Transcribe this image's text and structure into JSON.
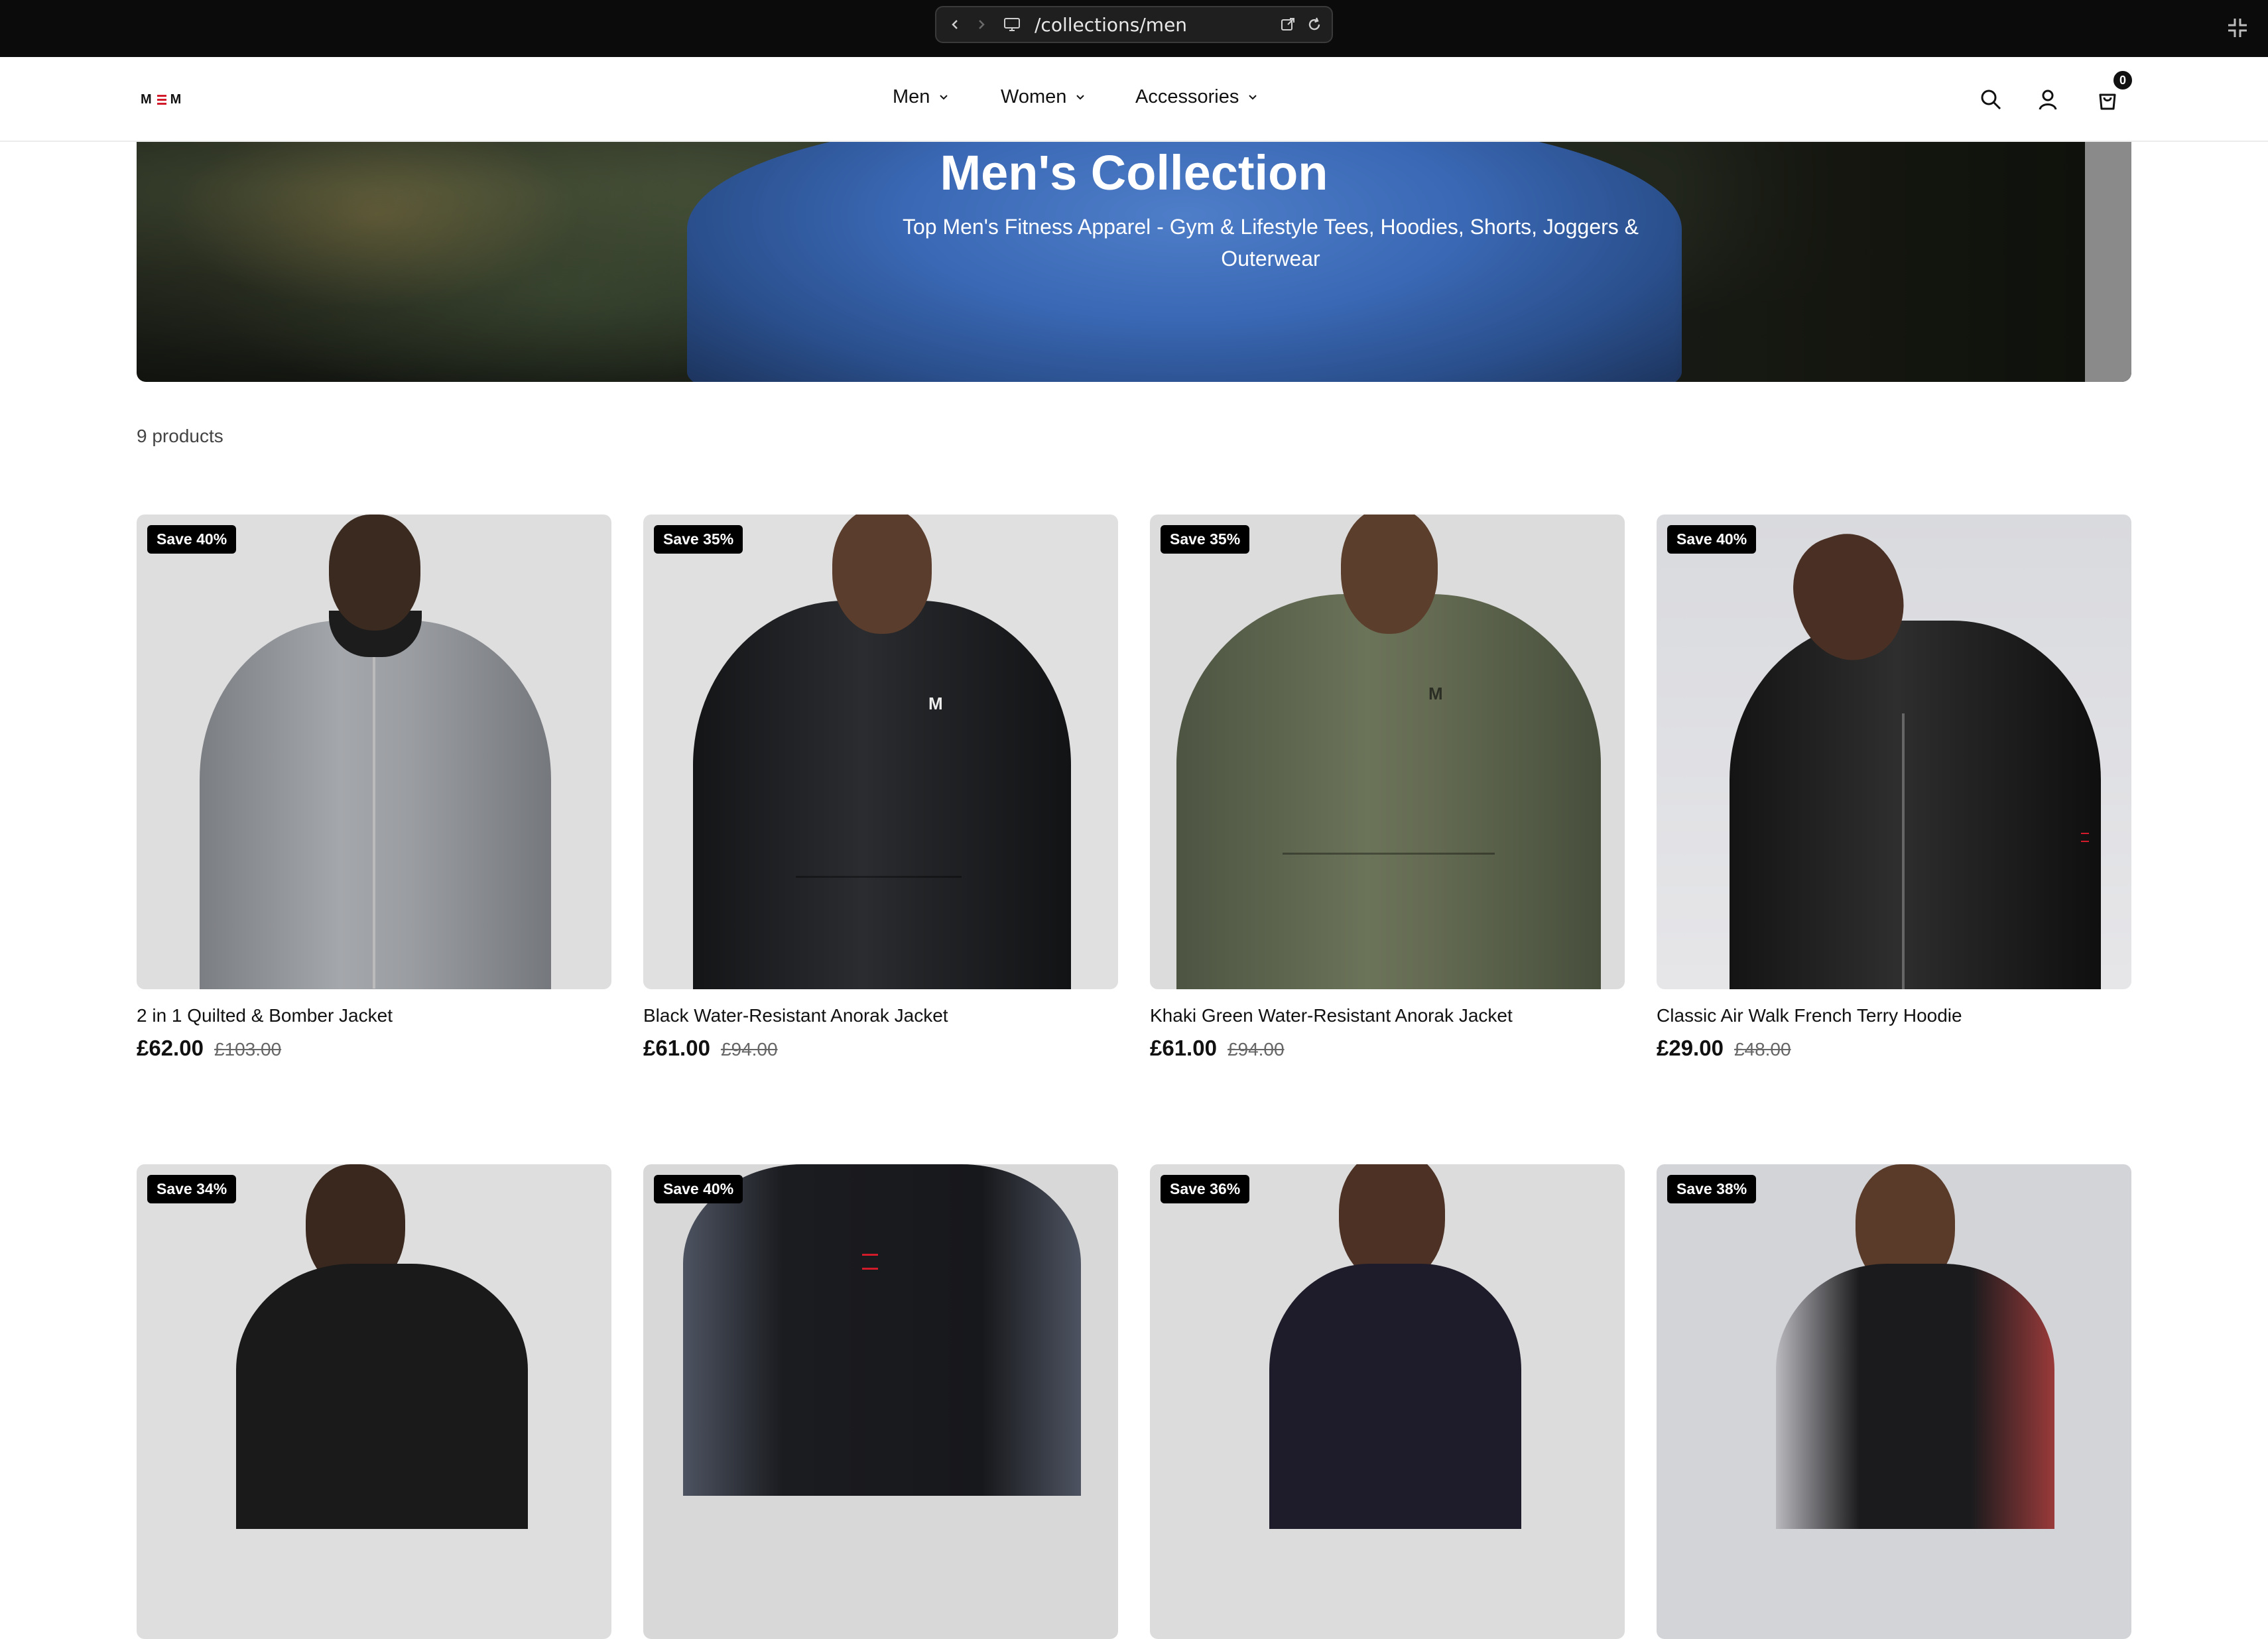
{
  "browser": {
    "url": "/collections/men",
    "back_icon": "chevron-left-icon",
    "forward_icon": "chevron-right-icon",
    "site_icon": "monitor-icon",
    "open_icon": "external-link-icon",
    "reload_icon": "reload-icon",
    "collapse_icon": "collapse-icon"
  },
  "header": {
    "logo_text": "M M",
    "nav": [
      {
        "label": "Men"
      },
      {
        "label": "Women"
      },
      {
        "label": "Accessories"
      }
    ],
    "cart_count": "0"
  },
  "hero": {
    "title": "Men's Collection",
    "subtitle": "Top Men's Fitness Apparel - Gym & Lifestyle Tees, Hoodies, Shorts, Joggers & Outerwear"
  },
  "collection": {
    "count_label": "9 products"
  },
  "products": [
    {
      "badge": "Save 40%",
      "name": "2 in 1 Quilted & Bomber Jacket",
      "price": "£62.00",
      "was": "£103.00"
    },
    {
      "badge": "Save 35%",
      "name": "Black Water-Resistant Anorak Jacket",
      "price": "£61.00",
      "was": "£94.00"
    },
    {
      "badge": "Save 35%",
      "name": "Khaki Green Water-Resistant Anorak Jacket",
      "price": "£61.00",
      "was": "£94.00"
    },
    {
      "badge": "Save 40%",
      "name": "Classic Air Walk French Terry Hoodie",
      "price": "£29.00",
      "was": "£48.00"
    },
    {
      "badge": "Save 34%"
    },
    {
      "badge": "Save 40%"
    },
    {
      "badge": "Save 36%"
    },
    {
      "badge": "Save 38%"
    }
  ],
  "colors": {
    "brand_red": "#d11a2a",
    "badge_bg": "#000000",
    "hero_shirt_blue": "#3a68b4"
  }
}
